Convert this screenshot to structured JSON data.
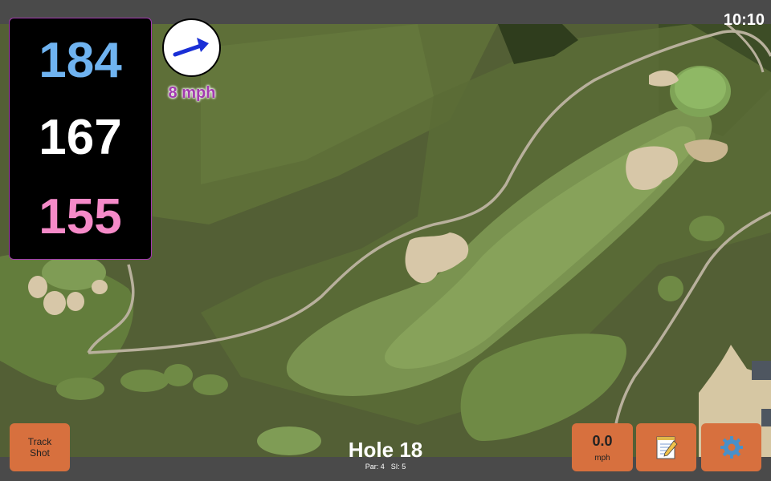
{
  "status_bar": {
    "clock": "10:10"
  },
  "yardages": {
    "back": "184",
    "middle": "167",
    "front": "155"
  },
  "wind": {
    "speed_label": "8 mph",
    "direction": "east-northeast"
  },
  "buttons": {
    "track_shot": "Track\nShot",
    "speed_value": "0.0",
    "speed_unit": "mph",
    "notes_icon": "notepad-icon",
    "settings_icon": "gear-icon"
  },
  "hole": {
    "title": "Hole 18",
    "par": "Par: 4",
    "stroke_index": "SI: 5"
  },
  "colors": {
    "back_yardage": "#6fb3f0",
    "middle_yardage": "#ffffff",
    "front_yardage": "#f58ac8",
    "accent_purple": "#a33ab0",
    "wind_arrow": "#1a2fd6",
    "button_orange": "#d7703e"
  }
}
